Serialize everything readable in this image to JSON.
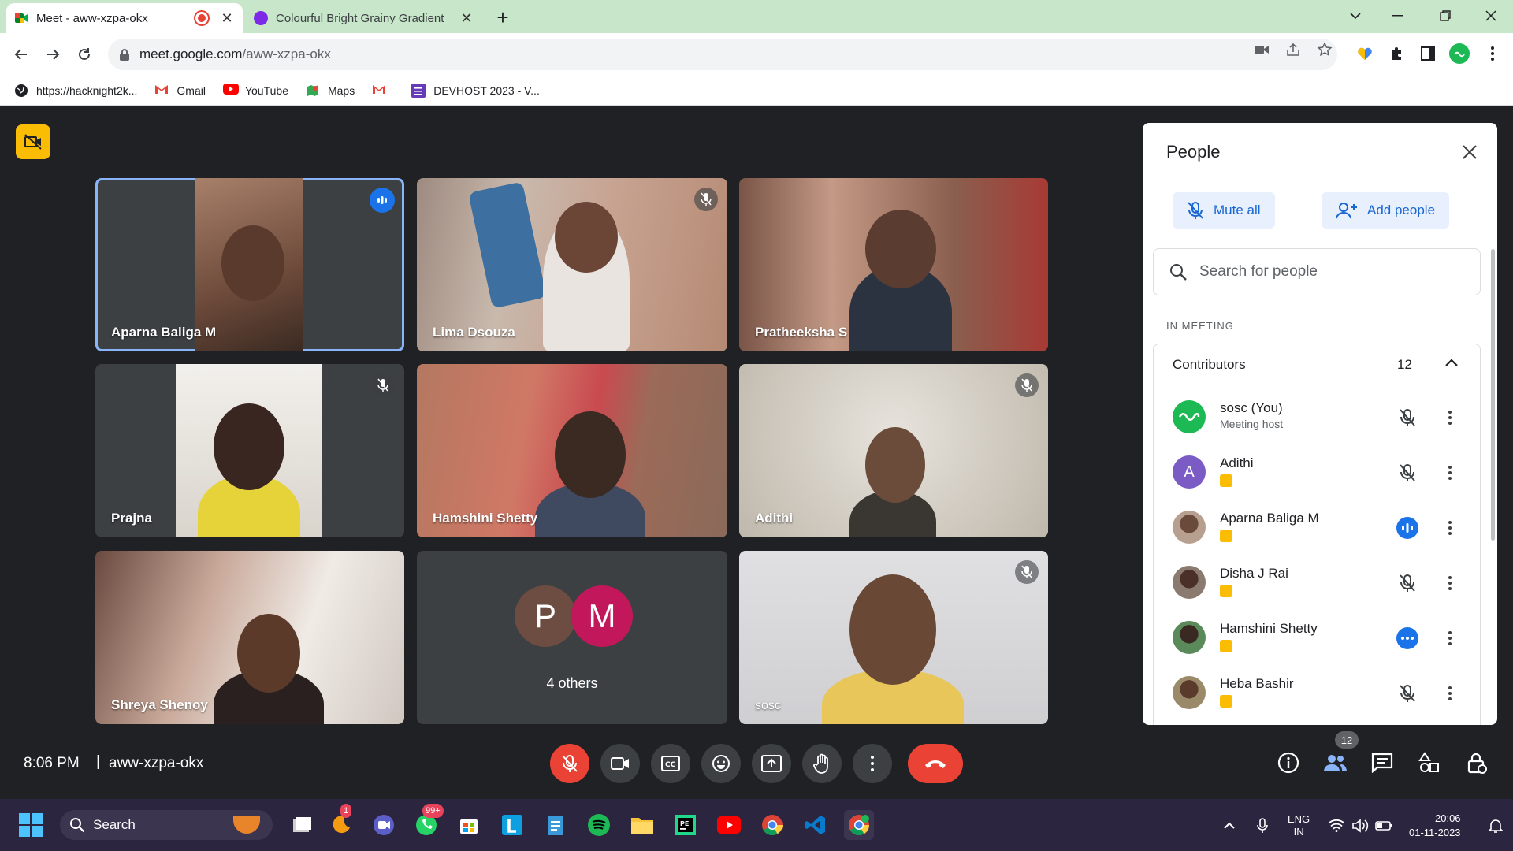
{
  "browser": {
    "tabs": [
      {
        "title": "Meet - aww-xzpa-okx",
        "active": true,
        "recording": true
      },
      {
        "title": "Colourful Bright Grainy Gradient",
        "active": false
      }
    ],
    "url_host": "meet.google.com",
    "url_path": "/aww-xzpa-okx",
    "bookmarks": [
      "https://hacknight2k...",
      "Gmail",
      "YouTube",
      "Maps",
      "",
      "DEVHOST 2023 - V..."
    ],
    "profile_color": "#1db954"
  },
  "meet": {
    "tiles": [
      {
        "name": "Aparna Baliga M",
        "state": "speaking"
      },
      {
        "name": "Lima Dsouza",
        "state": "muted"
      },
      {
        "name": "Pratheeksha S",
        "state": "none"
      },
      {
        "name": "Prajna",
        "state": "muted"
      },
      {
        "name": "Hamshini Shetty",
        "state": "none"
      },
      {
        "name": "Adithi",
        "state": "muted"
      },
      {
        "name": "Shreya Shenoy",
        "state": "none"
      },
      {
        "name": "sosc",
        "state": "muted"
      }
    ],
    "others": {
      "initials": [
        "P",
        "M"
      ],
      "label": "4 others",
      "colors": [
        "#6d4c41",
        "#c2185b"
      ]
    },
    "time": "8:06 PM",
    "separator": "|",
    "meeting_code": "aww-xzpa-okx",
    "people_count_badge": "12"
  },
  "panel": {
    "title": "People",
    "mute_all": "Mute all",
    "add_people": "Add people",
    "search_placeholder": "Search for people",
    "section": "IN MEETING",
    "group_label": "Contributors",
    "group_count": "12",
    "participants": [
      {
        "name": "sosc (You)",
        "sub": "Meeting host",
        "avatar": "logo",
        "mic": "muted"
      },
      {
        "name": "Adithi",
        "avatar": "A",
        "avatar_color": "#7b5cc4",
        "mic": "muted"
      },
      {
        "name": "Aparna Baliga M",
        "avatar": "photo",
        "mic": "speaking"
      },
      {
        "name": "Disha J Rai",
        "avatar": "photo",
        "mic": "muted"
      },
      {
        "name": "Hamshini Shetty",
        "avatar": "photo",
        "mic": "dots"
      },
      {
        "name": "Heba Bashir",
        "avatar": "photo",
        "mic": "muted"
      }
    ]
  },
  "taskbar": {
    "search_label": "Search",
    "badges": {
      "app1": "1",
      "whatsapp": "99+"
    },
    "lang_line1": "ENG",
    "lang_line2": "IN",
    "time": "20:06",
    "date": "01-11-2023"
  }
}
